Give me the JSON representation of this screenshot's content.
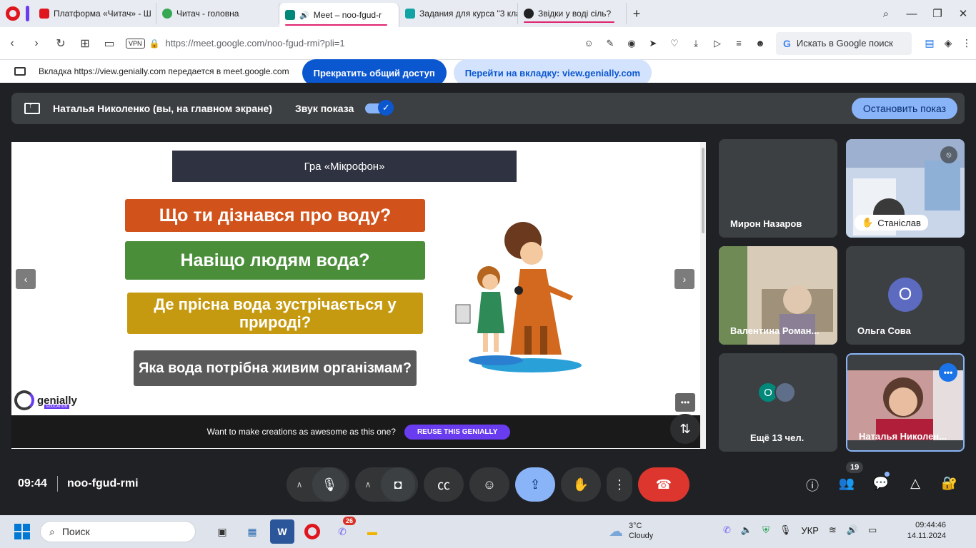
{
  "browser": {
    "tabs": [
      {
        "label": "Платформа «Читач» - Ш",
        "icon_color": "#e0161f"
      },
      {
        "label": "Читач - головна",
        "icon_color": "#34a853"
      },
      {
        "label": "Meet – noo-fgud-r",
        "icon_color": "#00897b"
      },
      {
        "label": "Задания для курса \"3 кла",
        "icon_color": "#12a4a4"
      },
      {
        "label": "Звідки у воді сіль?",
        "icon_color": "#222222"
      }
    ],
    "url": "https://meet.google.com/noo-fgud-rmi?pli=1",
    "vpn_label": "VPN",
    "search_placeholder": "Искать в Google поиск"
  },
  "share_banner": {
    "text": "Вкладка https://view.genially.com передается в meet.google.com",
    "stop_label": "Прекратить общий доступ",
    "goto_label": "Перейти на вкладку: view.genially.com"
  },
  "present_bar": {
    "presenter": "Наталья Николенко (вы, на главном экране)",
    "sound_label": "Звук показа",
    "stop_show_label": "Остановить показ"
  },
  "slide": {
    "title": "Гра «Мікрофон»",
    "questions": [
      "Що ти дізнався про воду?",
      "Навіщо людям вода?",
      "Де прісна вода зустрічається у природі?",
      "Яка вода потрібна живим організмам?"
    ],
    "logo_text": "genially",
    "logo_sub": "EDUCATION",
    "cta_text": "Want to make creations as awesome as this one?",
    "cta_button": "REUSE THIS GENIALLY"
  },
  "participants": [
    {
      "name": "Мирон Назаров"
    },
    {
      "name": "Станіслав"
    },
    {
      "name": "Валентина Роман..."
    },
    {
      "name": "Ольга Сова",
      "initial": "О"
    },
    {
      "name": "Ещё 13 чел.",
      "initial": "О"
    },
    {
      "name": "Наталья Николен..."
    }
  ],
  "meeting": {
    "time": "09:44",
    "code": "noo-fgud-rmi",
    "participants_count": "19"
  },
  "taskbar": {
    "search_label": "Поиск",
    "viber_badge": "26",
    "weather_temp": "3°C",
    "weather_desc": "Cloudy",
    "lang": "УКР",
    "clock_time": "09:44:46",
    "clock_date": "14.11.2024"
  }
}
